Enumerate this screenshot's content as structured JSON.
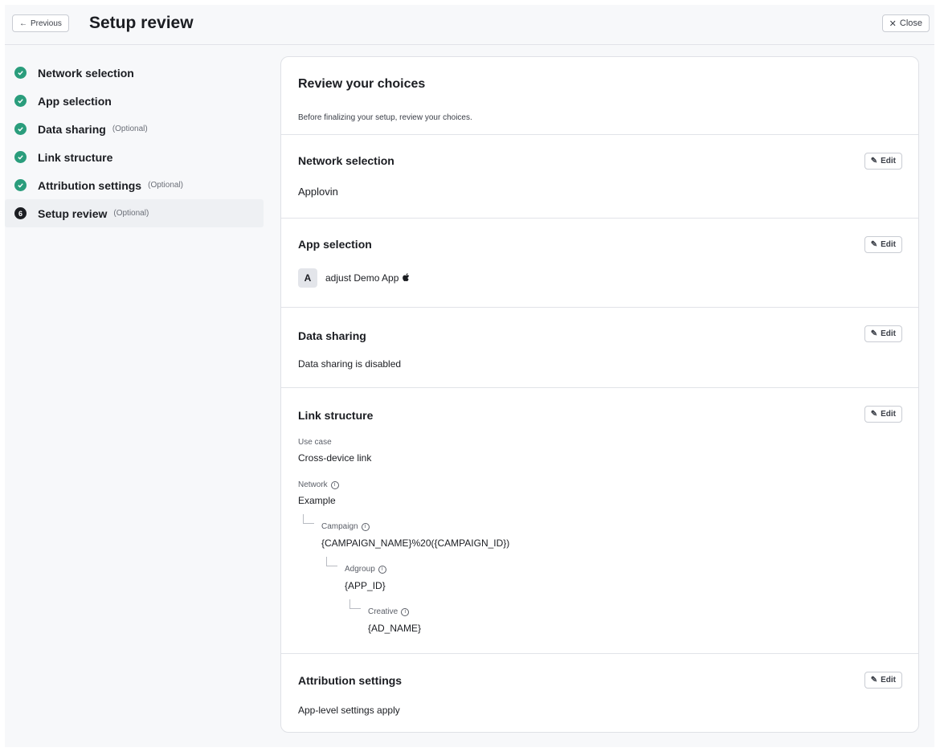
{
  "header": {
    "previous_label": "Previous",
    "title": "Setup review",
    "close_label": "Close"
  },
  "steps": [
    {
      "label": "Network selection",
      "optional": "",
      "status": "complete"
    },
    {
      "label": "App selection",
      "optional": "",
      "status": "complete"
    },
    {
      "label": "Data sharing",
      "optional": "(Optional)",
      "status": "complete"
    },
    {
      "label": "Link structure",
      "optional": "",
      "status": "complete"
    },
    {
      "label": "Attribution settings",
      "optional": "(Optional)",
      "status": "complete"
    },
    {
      "label": "Setup review",
      "optional": "(Optional)",
      "status": "current",
      "number": "6"
    }
  ],
  "review": {
    "title": "Review your choices",
    "description": "Before finalizing your setup, review your choices.",
    "edit_label": "Edit",
    "network": {
      "title": "Network selection",
      "value": "Applovin"
    },
    "app": {
      "title": "App selection",
      "avatar_letter": "A",
      "name": "adjust Demo App",
      "platform_icon": "apple-icon"
    },
    "data_sharing": {
      "title": "Data sharing",
      "value": "Data sharing is disabled"
    },
    "link": {
      "title": "Link structure",
      "use_case_label": "Use case",
      "use_case_value": "Cross-device link",
      "network_label": "Network",
      "network_value": "Example",
      "campaign_label": "Campaign",
      "campaign_value": "{CAMPAIGN_NAME}%20({CAMPAIGN_ID})",
      "adgroup_label": "Adgroup",
      "adgroup_value": "{APP_ID}",
      "creative_label": "Creative",
      "creative_value": "{AD_NAME}"
    },
    "attribution": {
      "title": "Attribution settings",
      "value": "App-level settings apply"
    }
  },
  "colors": {
    "check_green": "#2a9d7c",
    "background": "#f7f8fa"
  }
}
